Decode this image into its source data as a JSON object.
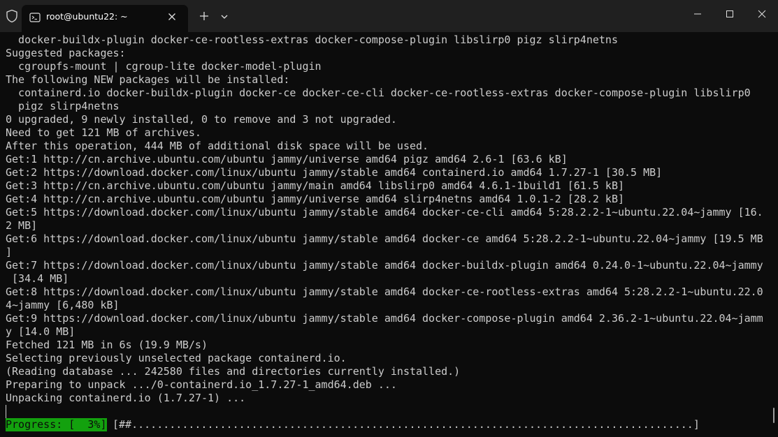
{
  "window": {
    "tab_title": "root@ubuntu22: ~",
    "icons": {
      "shield": "shield-icon",
      "terminal": "terminal-icon",
      "close_tab": "close-icon",
      "new_tab": "plus-icon",
      "dropdown": "chevron-down-icon",
      "minimize": "minimize-icon",
      "maximize": "maximize-icon",
      "close_window": "close-icon"
    }
  },
  "terminal": {
    "lines": [
      "  docker-buildx-plugin docker-ce-rootless-extras docker-compose-plugin libslirp0 pigz slirp4netns",
      "Suggested packages:",
      "  cgroupfs-mount | cgroup-lite docker-model-plugin",
      "The following NEW packages will be installed:",
      "  containerd.io docker-buildx-plugin docker-ce docker-ce-cli docker-ce-rootless-extras docker-compose-plugin libslirp0",
      "  pigz slirp4netns",
      "0 upgraded, 9 newly installed, 0 to remove and 3 not upgraded.",
      "Need to get 121 MB of archives.",
      "After this operation, 444 MB of additional disk space will be used.",
      "Get:1 http://cn.archive.ubuntu.com/ubuntu jammy/universe amd64 pigz amd64 2.6-1 [63.6 kB]",
      "Get:2 https://download.docker.com/linux/ubuntu jammy/stable amd64 containerd.io amd64 1.7.27-1 [30.5 MB]",
      "Get:3 http://cn.archive.ubuntu.com/ubuntu jammy/main amd64 libslirp0 amd64 4.6.1-1build1 [61.5 kB]",
      "Get:4 http://cn.archive.ubuntu.com/ubuntu jammy/universe amd64 slirp4netns amd64 1.0.1-2 [28.2 kB]",
      "Get:5 https://download.docker.com/linux/ubuntu jammy/stable amd64 docker-ce-cli amd64 5:28.2.2-1~ubuntu.22.04~jammy [16.",
      "2 MB]",
      "Get:6 https://download.docker.com/linux/ubuntu jammy/stable amd64 docker-ce amd64 5:28.2.2-1~ubuntu.22.04~jammy [19.5 MB",
      "]",
      "Get:7 https://download.docker.com/linux/ubuntu jammy/stable amd64 docker-buildx-plugin amd64 0.24.0-1~ubuntu.22.04~jammy",
      " [34.4 MB]",
      "Get:8 https://download.docker.com/linux/ubuntu jammy/stable amd64 docker-ce-rootless-extras amd64 5:28.2.2-1~ubuntu.22.0",
      "4~jammy [6,480 kB]",
      "Get:9 https://download.docker.com/linux/ubuntu jammy/stable amd64 docker-compose-plugin amd64 2.36.2-1~ubuntu.22.04~jamm",
      "y [14.0 MB]",
      "Fetched 121 MB in 6s (19.9 MB/s)",
      "Selecting previously unselected package containerd.io.",
      "(Reading database ... 242580 files and directories currently installed.)",
      "Preparing to unpack .../0-containerd.io_1.7.27-1_amd64.deb ...",
      "Unpacking containerd.io (1.7.27-1) ..."
    ],
    "progress_label": "Progress: [  3%]",
    "progress_bar": "[##.........................................................................................]",
    "progress_percent": 3
  },
  "colors": {
    "terminal_bg": "#0c0c0c",
    "titlebar_bg": "#202020",
    "text": "#cccccc",
    "progress_green": "#13a10e"
  }
}
